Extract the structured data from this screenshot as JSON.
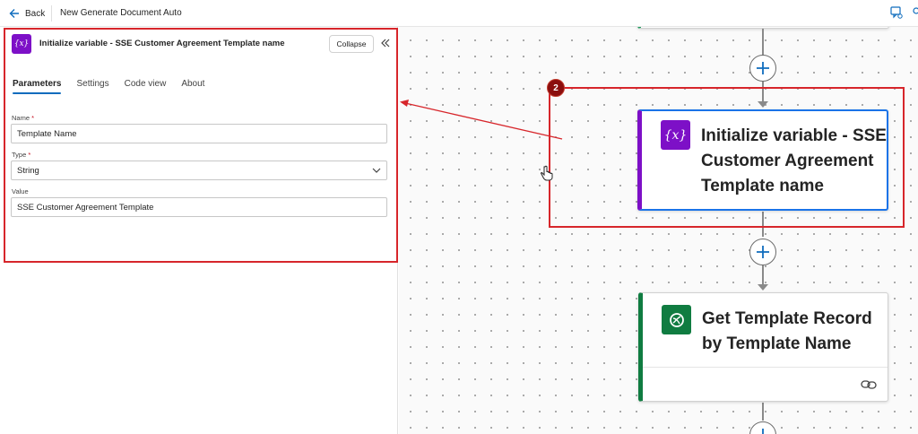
{
  "topbar": {
    "back_label": "Back",
    "flow_title": "New Generate Document Auto"
  },
  "panel": {
    "icon_glyph": "{x}",
    "title": "Initialize variable - SSE Customer Agreement Template name",
    "collapse_label": "Collapse",
    "tabs": [
      {
        "label": "Parameters",
        "active": true
      },
      {
        "label": "Settings",
        "active": false
      },
      {
        "label": "Code view",
        "active": false
      },
      {
        "label": "About",
        "active": false
      }
    ],
    "fields": {
      "name_label": "Name",
      "name_required": "*",
      "name_value": "Template Name",
      "type_label": "Type",
      "type_required": "*",
      "type_value": "String",
      "value_label": "Value",
      "value_value": "SSE Customer Agreement Template"
    }
  },
  "canvas": {
    "badge_number": "2",
    "init_card": {
      "icon_glyph": "{x}",
      "title": "Initialize variable - SSE Customer Agreement Template name"
    },
    "get_card": {
      "title": "Get Template Record by Template Name"
    }
  },
  "icons": {
    "back": "arrow-left-icon",
    "collapse_panel": "double-chevron-left-icon",
    "dropdown": "chevron-down-icon",
    "add_step": "plus-icon",
    "dataverse": "dataverse-icon",
    "link": "link-icon",
    "cursor": "hand-cursor-icon"
  },
  "colors": {
    "variable_purple": "#7d10c7",
    "dataverse_green": "#107c41",
    "selected_blue": "#1a73e8",
    "annotation_red": "#d7262b",
    "badge_dark_red": "#8b0e0e",
    "tab_underline": "#0f6cbd"
  }
}
